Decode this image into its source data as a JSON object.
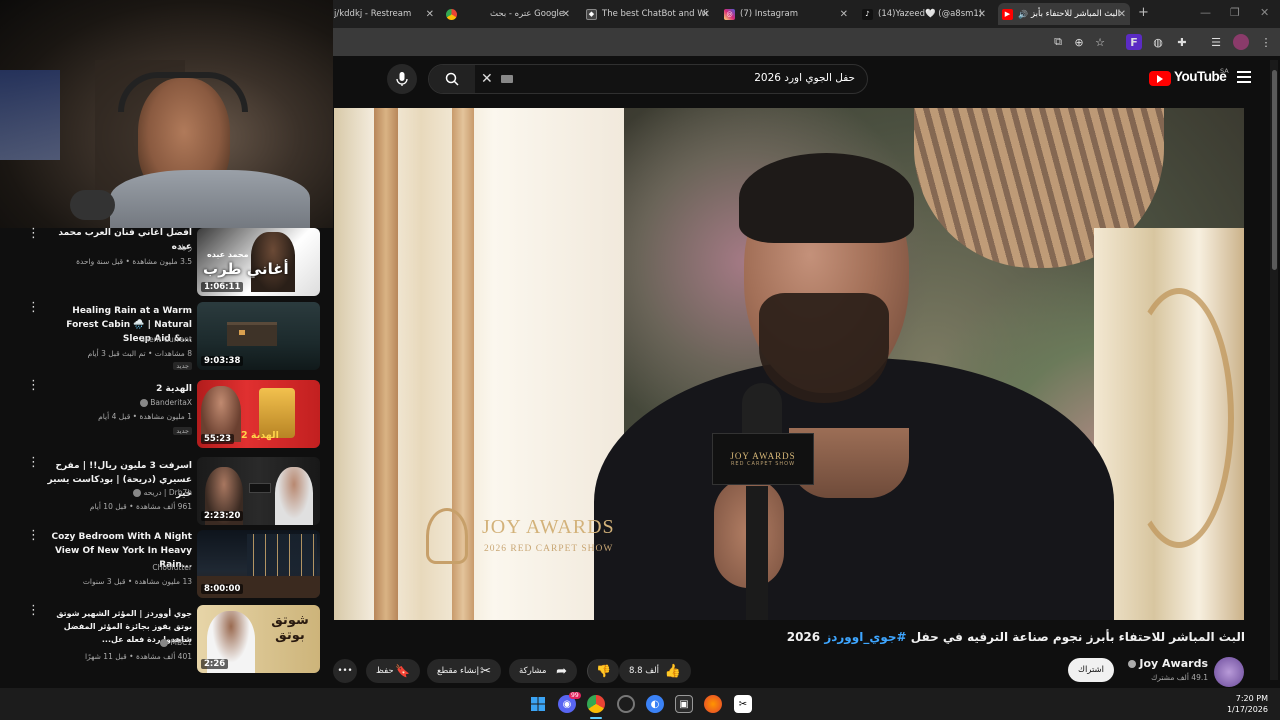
{
  "browser": {
    "tabs": [
      {
        "title": "j/kddkj - Restream",
        "favicon": "restream-icon",
        "color": "#333"
      },
      {
        "title": "",
        "favicon": "chrome-icon",
        "color": "#4285f4"
      },
      {
        "title": "عتره - بحث Google",
        "favicon": "google-icon",
        "color": "#34a853"
      },
      {
        "title": "The best ChatBot and Wi",
        "favicon": "chatbot-icon",
        "color": "#555"
      },
      {
        "title": "(7) Instagram",
        "favicon": "instagram-icon",
        "color": "#d62976"
      },
      {
        "title": "(14)Yazeed🤍 (@a8sm1)",
        "favicon": "tiktok-icon",
        "color": "#111"
      },
      {
        "title": "البث المباشر للاحتفاء بأبز",
        "favicon": "youtube-icon",
        "color": "#ff0000"
      }
    ],
    "new_tab": "+",
    "window_controls": {
      "minimize": "—",
      "maximize": "❐",
      "close": "✕"
    }
  },
  "youtube": {
    "logo_text": "YouTube",
    "region": "SA",
    "search_value": "حفل الجوي اورد 2026",
    "player": {
      "brand_title": "JOY AWARDS",
      "brand_subtitle": "2026 RED CARPET SHOW",
      "mic_brand": "JOY AWARDS",
      "mic_sub": "RED CARPET SHOW"
    },
    "video": {
      "title_main": "البث المباشر للاحتفاء بأبرز نجوم صناعة الترفيه في حفل",
      "title_tag": "#جوي_اووردز",
      "title_year": "2026",
      "channel_name": "Joy Awards",
      "subscribers": "49.1 ألف مشترك",
      "subscribe_label": "اشتراك",
      "like_count": "8.8 ألف",
      "share_label": "مشاركة",
      "clip_label": "إنشاء مقطع",
      "save_label": "حفظ",
      "more_label": "•••"
    },
    "recommendations": [
      {
        "title": "افضل اغاني فنان العرب محمد عبده",
        "channel": "رحلة",
        "stats": "3.5 مليون مشاهدة • قبل سنة واحدة",
        "duration": "1:06:11",
        "thumb_text": "أغاني طرب",
        "thumb_sub": "محمد عبده",
        "new": ""
      },
      {
        "title": "Healing Rain at a Warm Forest Cabin 🌧️ | Natural Sleep Aid &...",
        "channel": "Silent Current",
        "stats": "8 مشاهدات • تم البث قبل 3 أيام",
        "duration": "9:03:38",
        "thumb_text": "",
        "thumb_sub": "",
        "new": "جديد"
      },
      {
        "title": "الهدية 2",
        "channel": "BanderitaX",
        "stats": "1 مليون مشاهدة • قبل 4 أيام",
        "duration": "55:23",
        "thumb_text": "الهدية 2",
        "thumb_sub": "",
        "new": "جديد"
      },
      {
        "title": "اسرفت 3 مليون ريال!! | مفرح عسيري (دريحة) | بودكاست يسير خير",
        "channel": "Drb7h | دريحه",
        "stats": "961 ألف مشاهدة • قبل 10 أيام",
        "duration": "2:23:20",
        "thumb_text": "",
        "thumb_sub": "",
        "new": ""
      },
      {
        "title": "Cozy Bedroom With A Night View Of New York In Heavy Rain...",
        "channel": "Choolutter",
        "stats": "13 مليون مشاهدة • قبل 3 سنوات",
        "duration": "8:00:00",
        "thumb_text": "",
        "thumb_sub": "",
        "new": ""
      },
      {
        "title": "جوي أووردز | المؤثر الشهير شوتق بوتق يفوز بجائزة المؤثر المفضل شاهدوا ردة فعله عل...",
        "channel": "MBC1",
        "stats": "401 ألف مشاهدة • قبل 11 شهرًا",
        "duration": "2:26",
        "thumb_text": "شوتق بوتق",
        "thumb_sub": "",
        "new": ""
      }
    ]
  },
  "taskbar": {
    "time": "7:20 PM",
    "date": "1/17/2026",
    "discord_badge": "99"
  }
}
